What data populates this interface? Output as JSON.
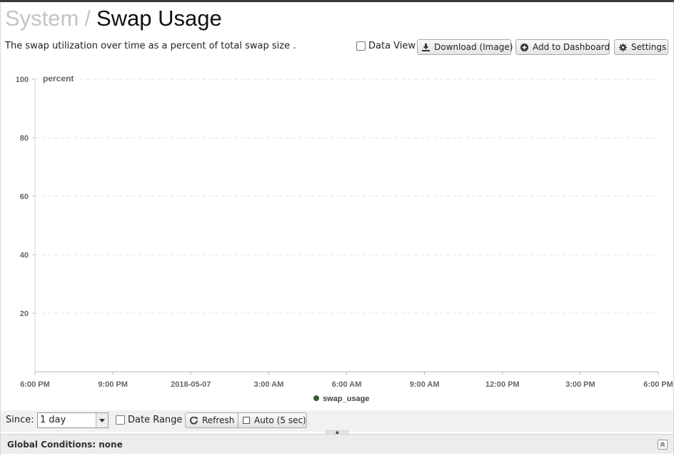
{
  "header": {
    "breadcrumb": "System",
    "separator": "/",
    "title": "Swap Usage",
    "description": "The swap utilization over time as a percent of total swap size ."
  },
  "toolbar": {
    "data_view_label": "Data View",
    "data_view_checked": false,
    "download_label": "Download (Image)",
    "download_icon": "download-icon",
    "add_label": "Add to Dashboard",
    "add_icon": "plus-circle-icon",
    "settings_label": "Settings",
    "settings_icon": "gear-icon"
  },
  "chart_data": {
    "type": "line",
    "title": "",
    "ylabel": "percent",
    "xlabel": "",
    "ylim": [
      0,
      100
    ],
    "y_ticks": [
      "20",
      "40",
      "60",
      "80",
      "100"
    ],
    "y_tick_values": [
      20,
      40,
      60,
      80,
      100
    ],
    "x_ticks": [
      "6:00 PM",
      "9:00 PM",
      "2018-05-07",
      "3:00 AM",
      "6:00 AM",
      "9:00 AM",
      "12:00 PM",
      "3:00 PM",
      "6:00 PM"
    ],
    "grid": true,
    "legend_position": "bottom",
    "series": [
      {
        "name": "swap_usage",
        "color": "#2e5e2e",
        "values": []
      }
    ]
  },
  "controls": {
    "since_label": "Since:",
    "since_value": "1 day",
    "date_range_label": "Date Range",
    "date_range_checked": false,
    "refresh_label": "Refresh",
    "refresh_icon": "refresh-icon",
    "auto_label": "Auto (5 sec)",
    "auto_checked": false
  },
  "footer": {
    "global_conditions": "Global Conditions: none",
    "collapse_icon": "double-chevron-up-icon"
  }
}
